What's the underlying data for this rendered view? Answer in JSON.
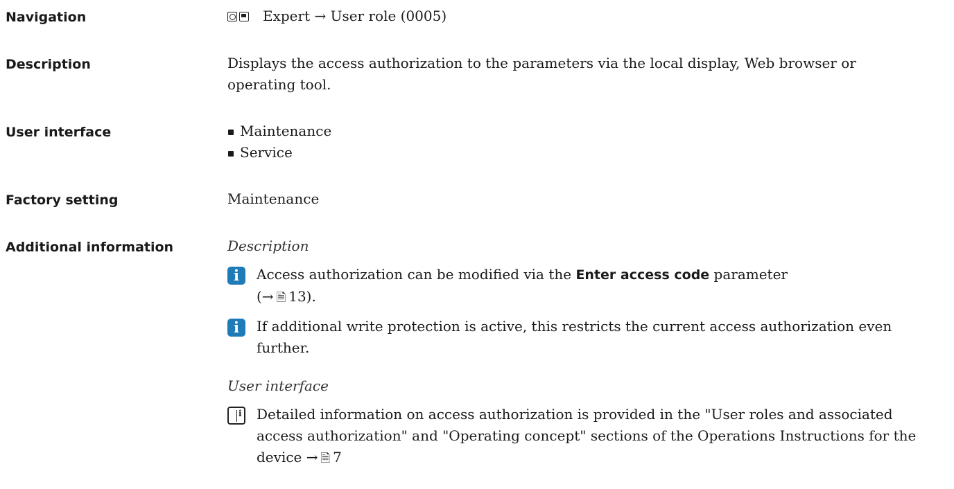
{
  "navigation": {
    "label": "Navigation",
    "path": "Expert → User role (0005)"
  },
  "description": {
    "label": "Description",
    "text": "Displays the access authorization to the parameters via the local display, Web browser or operating tool."
  },
  "user_interface": {
    "label": "User interface",
    "items": [
      "Maintenance",
      "Service"
    ]
  },
  "factory_setting": {
    "label": "Factory setting",
    "value": "Maintenance"
  },
  "additional_information": {
    "label": "Additional information",
    "description_heading": "Description",
    "note1_pre": "Access authorization can be modified via the ",
    "note1_bold": "Enter access code",
    "note1_post": " parameter",
    "note1_ref_open": "(→",
    "note1_ref_page": "13).",
    "note2": "If additional write protection is active, this restricts the current access authorization even further.",
    "user_interface_heading": "User interface",
    "note3": "Detailed information on access authorization is provided in the \"User roles and associated access authorization\" and \"Operating concept\" sections of the Operations Instructions for the device →",
    "note3_ref_page": "7"
  },
  "icons": {
    "navigation_icons": [
      "operating-key-icon",
      "display-key-icon"
    ],
    "tip_icon": "info-icon",
    "reference_icon": "manual-reference-icon",
    "page_icon": "page-reference-icon",
    "accent_color": "#1f7ab8"
  }
}
